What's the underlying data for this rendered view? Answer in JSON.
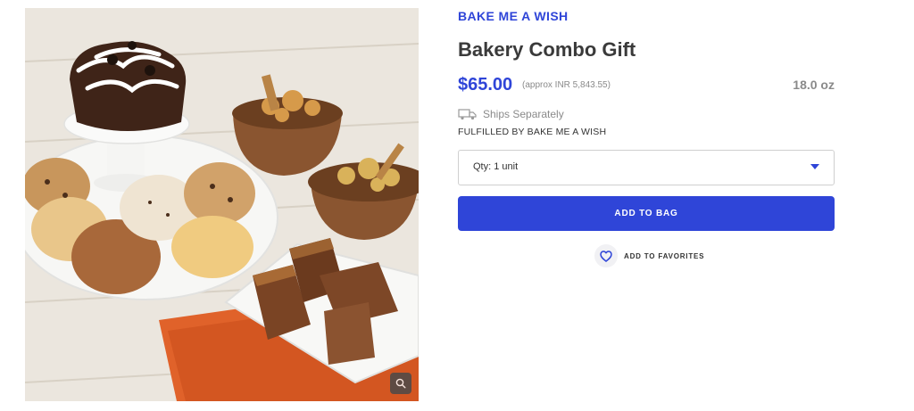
{
  "product": {
    "brand": "BAKE ME A WISH",
    "title": "Bakery Combo Gift",
    "price": "$65.00",
    "price_approx": "(approx INR 5,843.55)",
    "weight": "18.0 oz",
    "image_alt": "Bakery Combo Gift"
  },
  "shipping": {
    "ships_text": "Ships Separately",
    "ships_icon": "truck-icon",
    "fulfilled_by": "FULFILLED BY BAKE ME A WISH"
  },
  "quantity": {
    "selected": "Qty: 1 unit"
  },
  "actions": {
    "add_to_bag": "ADD TO BAG",
    "add_to_favorites": "ADD TO FAVORITES",
    "favorites_icon": "heart-icon",
    "zoom_icon": "zoom-icon"
  },
  "colors": {
    "accent": "#2f45d8",
    "muted_text": "#8a8a8a",
    "dark_text": "#3a3a3a"
  }
}
